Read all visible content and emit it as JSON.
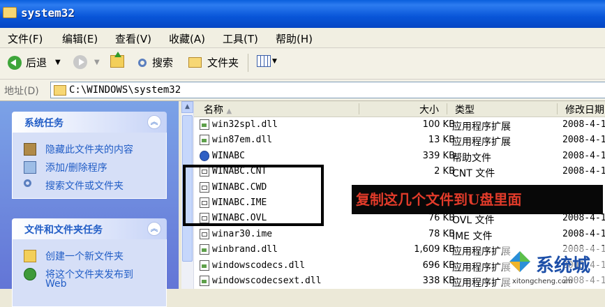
{
  "window": {
    "title": "system32"
  },
  "menu": [
    {
      "label": "文件(F)"
    },
    {
      "label": "编辑(E)"
    },
    {
      "label": "查看(V)"
    },
    {
      "label": "收藏(A)"
    },
    {
      "label": "工具(T)"
    },
    {
      "label": "帮助(H)"
    }
  ],
  "toolbar": {
    "back": "后退",
    "search": "搜索",
    "folders": "文件夹"
  },
  "address": {
    "label": "地址(D)",
    "path": "C:\\WINDOWS\\system32"
  },
  "left_pane": {
    "system_tasks": {
      "title": "系统任务",
      "items": [
        {
          "label": "隐藏此文件夹的内容",
          "icon": "hide-folder-icon"
        },
        {
          "label": "添加/删除程序",
          "icon": "add-remove-programs-icon"
        },
        {
          "label": "搜索文件或文件夹",
          "icon": "search-icon"
        }
      ]
    },
    "file_tasks": {
      "title": "文件和文件夹任务",
      "items": [
        {
          "label": "创建一个新文件夹",
          "icon": "new-folder-icon"
        },
        {
          "label": "将这个文件夹发布到",
          "icon": "publish-web-icon"
        },
        {
          "label": "Web",
          "icon": ""
        }
      ]
    }
  },
  "columns": {
    "name": "名称",
    "size": "大小",
    "type": "类型",
    "modified": "修改日期"
  },
  "files": [
    {
      "name": "win32spl.dll",
      "size": "100 KB",
      "type": "应用程序扩展",
      "date": "2008-4-1",
      "icon": "dll"
    },
    {
      "name": "win87em.dll",
      "size": "13 KB",
      "type": "应用程序扩展",
      "date": "2008-4-1",
      "icon": "dll"
    },
    {
      "name": "WINABC",
      "size": "339 KB",
      "type": "帮助文件",
      "date": "2008-4-1",
      "icon": "help"
    },
    {
      "name": "WINABC.CNT",
      "size": "2 KB",
      "type": "CNT 文件",
      "date": "2008-4-1",
      "icon": "sys"
    },
    {
      "name": "WINABC.CWD",
      "size": "",
      "type": "",
      "date": "",
      "icon": "sys"
    },
    {
      "name": "WINABC.IME",
      "size": "",
      "type": "",
      "date": "",
      "icon": "sys"
    },
    {
      "name": "WINABC.OVL",
      "size": "76 KB",
      "type": "OVL 文件",
      "date": "2008-4-1",
      "icon": "sys"
    },
    {
      "name": "winar30.ime",
      "size": "78 KB",
      "type": "IME 文件",
      "date": "2008-4-1",
      "icon": "sys"
    },
    {
      "name": "winbrand.dll",
      "size": "1,609 KB",
      "type": "应用程序扩展",
      "date": "2008-4-1",
      "icon": "dll"
    },
    {
      "name": "windowscodecs.dll",
      "size": "696 KB",
      "type": "应用程序扩展",
      "date": "2008-4-1",
      "icon": "dll"
    },
    {
      "name": "windowscodecsext.dll",
      "size": "338 KB",
      "type": "应用程序扩展",
      "date": "2008-4-1",
      "icon": "dll"
    }
  ],
  "annotation": {
    "text": "复制这几个文件到U盘里面"
  },
  "watermark": {
    "brand": "系统城",
    "url": "xitongcheng.com"
  },
  "colors": {
    "title_bar": "#0a5fdc",
    "task_link": "#215dc6",
    "annotation_text": "#e23b2a"
  }
}
